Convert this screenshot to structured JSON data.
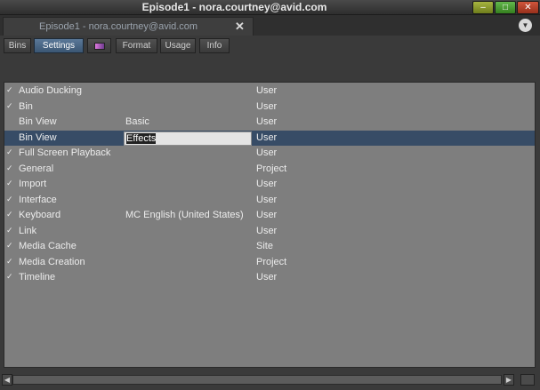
{
  "window": {
    "title": "Episode1 - nora.courtney@avid.com",
    "minimize": "–",
    "maximize": "□",
    "close": "✕"
  },
  "tab": {
    "title": "Episode1 - nora.courtney@avid.com",
    "close": "✕"
  },
  "toolbar": {
    "bins": "Bins",
    "settings": "Settings",
    "format": "Format",
    "usage": "Usage",
    "info": "Info"
  },
  "rows": [
    {
      "check": "✓",
      "name": "Audio Ducking",
      "value": "",
      "scope": "User"
    },
    {
      "check": "✓",
      "name": "Bin",
      "value": "",
      "scope": "User"
    },
    {
      "check": "",
      "name": "Bin View",
      "value": "Basic",
      "scope": "User"
    },
    {
      "check": "",
      "name": "Bin View",
      "value": "Effects",
      "scope": "User"
    },
    {
      "check": "✓",
      "name": "Full Screen Playback",
      "value": "",
      "scope": "User"
    },
    {
      "check": "✓",
      "name": "General",
      "value": "",
      "scope": "Project"
    },
    {
      "check": "✓",
      "name": "Import",
      "value": "",
      "scope": "User"
    },
    {
      "check": "✓",
      "name": "Interface",
      "value": "",
      "scope": "User"
    },
    {
      "check": "✓",
      "name": "Keyboard",
      "value": "MC English (United States)",
      "scope": "User"
    },
    {
      "check": "✓",
      "name": "Link",
      "value": "",
      "scope": "User"
    },
    {
      "check": "✓",
      "name": "Media Cache",
      "value": "",
      "scope": "Site"
    },
    {
      "check": "✓",
      "name": "Media Creation",
      "value": "",
      "scope": "Project"
    },
    {
      "check": "✓",
      "name": "Timeline",
      "value": "",
      "scope": "User"
    }
  ],
  "scroll": {
    "left": "◀",
    "right": "▶"
  },
  "colors": {
    "accent": "#374c66",
    "list_bg": "#7e7e7e",
    "close": "#c0432b"
  }
}
